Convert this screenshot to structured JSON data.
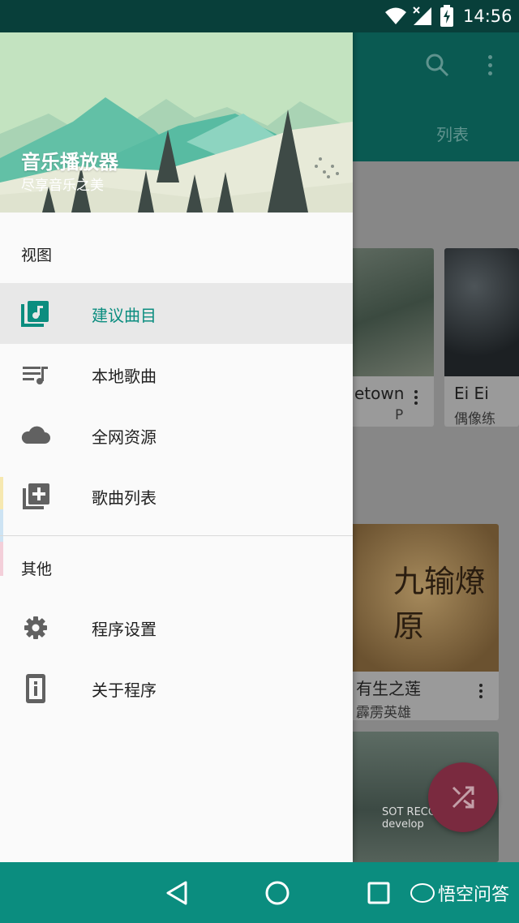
{
  "status_bar": {
    "time": "14:56"
  },
  "drawer": {
    "app_title": "音乐播放器",
    "app_subtitle": "尽享音乐之美",
    "section_view": "视图",
    "section_other": "其他",
    "items": [
      {
        "label": "建议曲目",
        "icon": "suggested-music-icon",
        "active": true
      },
      {
        "label": "本地歌曲",
        "icon": "playlist-icon"
      },
      {
        "label": "全网资源",
        "icon": "cloud-icon"
      },
      {
        "label": "歌曲列表",
        "icon": "add-to-list-icon"
      },
      {
        "label": "程序设置",
        "icon": "gear-icon"
      },
      {
        "label": "关于程序",
        "icon": "info-icon"
      }
    ],
    "accent_color": "#0b8d7f"
  },
  "background_app": {
    "tab_label": "列表",
    "cards": [
      {
        "title": "etown",
        "subtitle": "P"
      },
      {
        "title": "Ei Ei",
        "subtitle": "偶像练"
      },
      {
        "title": "有生之莲",
        "subtitle": "霹雳英雄",
        "art_text": "九输燎原"
      },
      {
        "art_text": "SOT RECORDS develop"
      }
    ]
  },
  "watermark": "悟空问答"
}
